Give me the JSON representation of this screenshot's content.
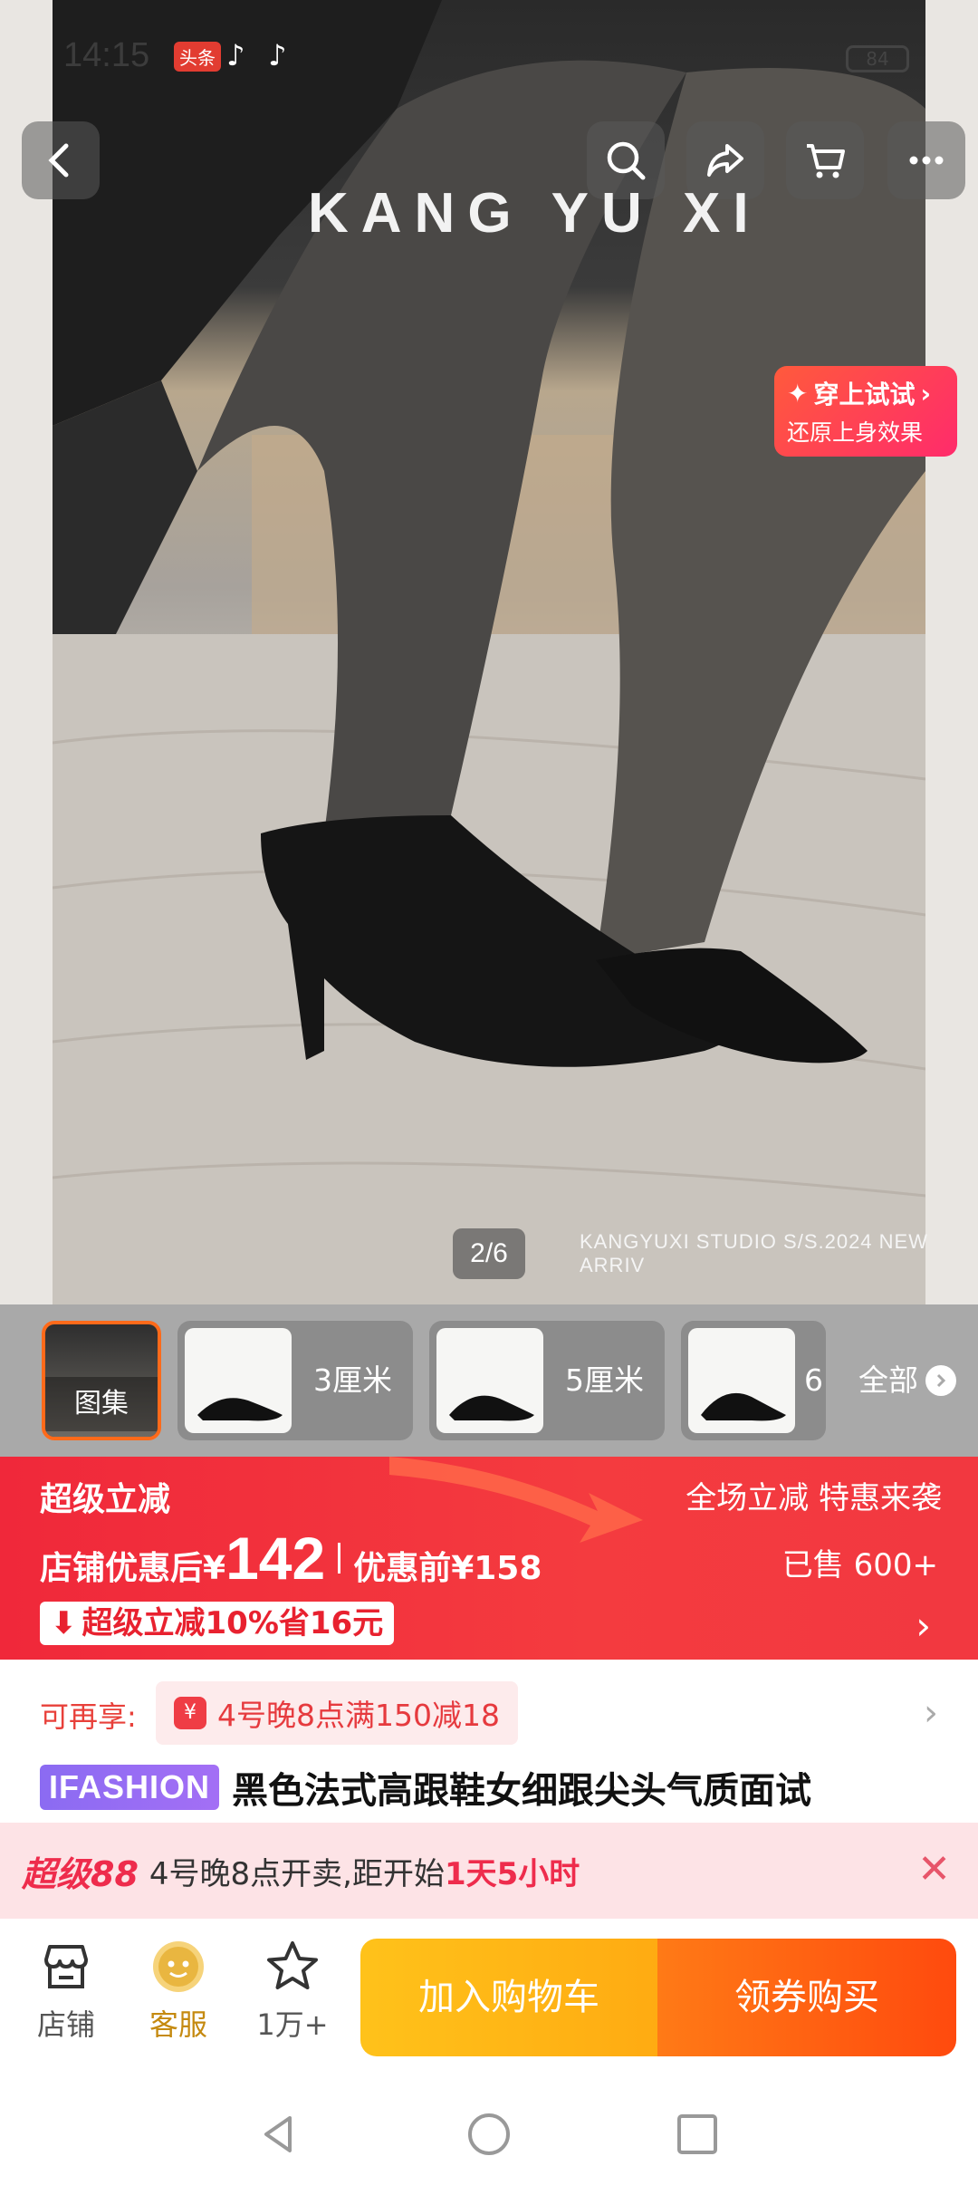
{
  "status_bar": {
    "time": "14:15",
    "badge": "头条",
    "tiktok_glyph": "♪",
    "battery": "84"
  },
  "hero": {
    "brand_logo": "KANG YU XI",
    "studio_text": "KANGYUXI STUDIO S/S.2024 NEW ARRIV",
    "page_indicator": "2/6",
    "try_on": {
      "title": "穿上试试",
      "subtitle": "还原上身效果"
    }
  },
  "thumbnails": {
    "items": [
      {
        "label": "图集"
      },
      {
        "label": "3厘米"
      },
      {
        "label": "5厘米"
      },
      {
        "label": "6"
      }
    ],
    "all_label": "全部"
  },
  "promo": {
    "title": "超级立减",
    "right_title": "全场立减 特惠来袭",
    "price_label": "店铺优惠后¥",
    "price": "142",
    "before_label": "优惠前¥158",
    "sold": "已售 600+",
    "tag": "超级立减10%省16元",
    "tag_icon": "⬇",
    "arrow": "›"
  },
  "coupon": {
    "label": "可再享:",
    "icon_text": "¥",
    "text": "4号晚8点满150减18",
    "chevron": "›"
  },
  "product": {
    "brand": "IFASHION",
    "title": "黑色法式高跟鞋女细跟尖头气质面试"
  },
  "notice": {
    "brand": "超级88",
    "text": "4号晚8点开卖,距开始",
    "highlight": "1天5小时",
    "close": "✕"
  },
  "actions": {
    "store_label": "店铺",
    "service_label": "客服",
    "favorite_label": "1万+",
    "cart_button": "加入购物车",
    "buy_button": "领券购买"
  },
  "colors": {
    "promo_red": "#f0283a",
    "cart_yellow": "#ffb714",
    "buy_orange": "#ff5a10",
    "brand_purple": "#8b6bf2"
  }
}
